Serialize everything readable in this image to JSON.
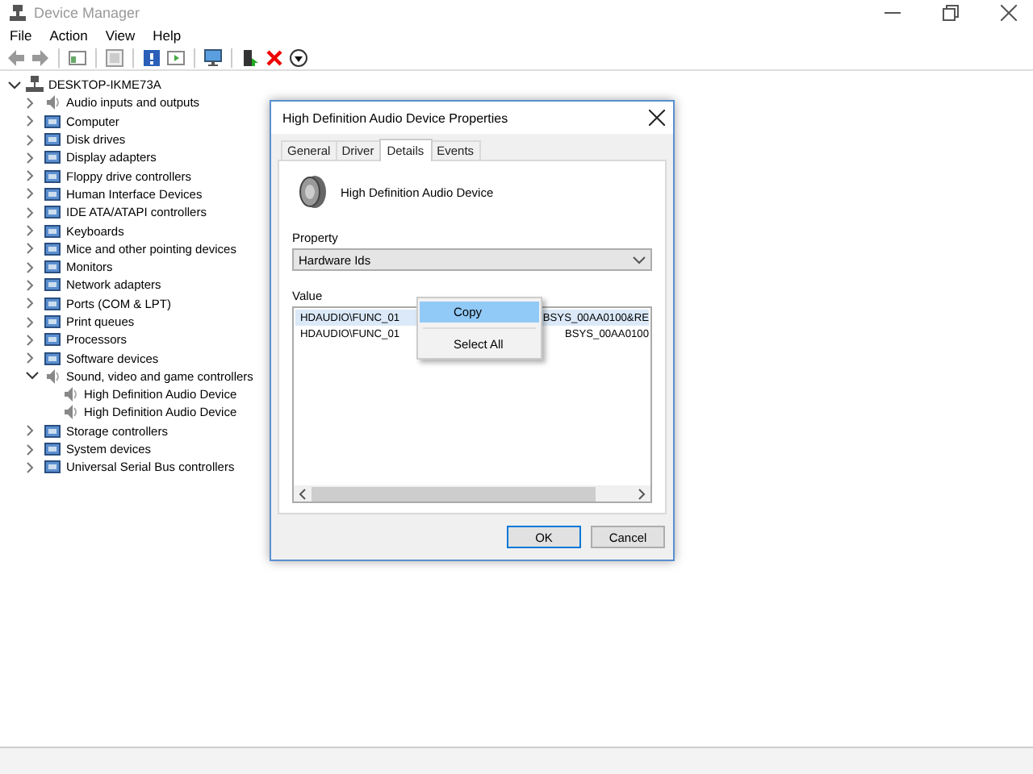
{
  "window": {
    "title": "Device Manager"
  },
  "menu": [
    "File",
    "Action",
    "View",
    "Help"
  ],
  "tree": {
    "label": "DESKTOP-IKME73A",
    "expanded": true,
    "children": [
      {
        "label": "Audio inputs and outputs",
        "expanded": false
      },
      {
        "label": "Computer",
        "expanded": false
      },
      {
        "label": "Disk drives",
        "expanded": false
      },
      {
        "label": "Display adapters",
        "expanded": false
      },
      {
        "label": "Floppy drive controllers",
        "expanded": false
      },
      {
        "label": "Human Interface Devices",
        "expanded": false
      },
      {
        "label": "IDE ATA/ATAPI controllers",
        "expanded": false
      },
      {
        "label": "Keyboards",
        "expanded": false
      },
      {
        "label": "Mice and other pointing devices",
        "expanded": false
      },
      {
        "label": "Monitors",
        "expanded": false
      },
      {
        "label": "Network adapters",
        "expanded": false
      },
      {
        "label": "Ports (COM & LPT)",
        "expanded": false
      },
      {
        "label": "Print queues",
        "expanded": false
      },
      {
        "label": "Processors",
        "expanded": false
      },
      {
        "label": "Software devices",
        "expanded": false
      },
      {
        "label": "Sound, video and game controllers",
        "expanded": true,
        "children": [
          {
            "label": "High Definition Audio Device"
          },
          {
            "label": "High Definition Audio Device"
          }
        ]
      },
      {
        "label": "Storage controllers",
        "expanded": false
      },
      {
        "label": "System devices",
        "expanded": false
      },
      {
        "label": "Universal Serial Bus controllers",
        "expanded": false
      }
    ]
  },
  "dialog": {
    "title": "High Definition Audio Device Properties",
    "tabs": [
      {
        "label": "General",
        "selected": false
      },
      {
        "label": "Driver",
        "selected": false
      },
      {
        "label": "Details",
        "selected": true
      },
      {
        "label": "Events",
        "selected": false
      }
    ],
    "device_name": "High Definition Audio Device",
    "property_label": "Property",
    "property_value": "Hardware Ids",
    "value_label": "Value",
    "value_rows": [
      {
        "text_start": "HDAUDIO\\FUNC_01",
        "text_end": "BSYS_00AA0100&RE",
        "selected": true
      },
      {
        "text_start": "HDAUDIO\\FUNC_01",
        "text_end": "BSYS_00AA0100",
        "selected": false
      }
    ],
    "context_menu": [
      {
        "label": "Copy",
        "selected": true
      },
      {
        "label": "Select All",
        "selected": false
      }
    ],
    "buttons": [
      {
        "label": "OK",
        "default": true
      },
      {
        "label": "Cancel",
        "default": false
      }
    ]
  }
}
